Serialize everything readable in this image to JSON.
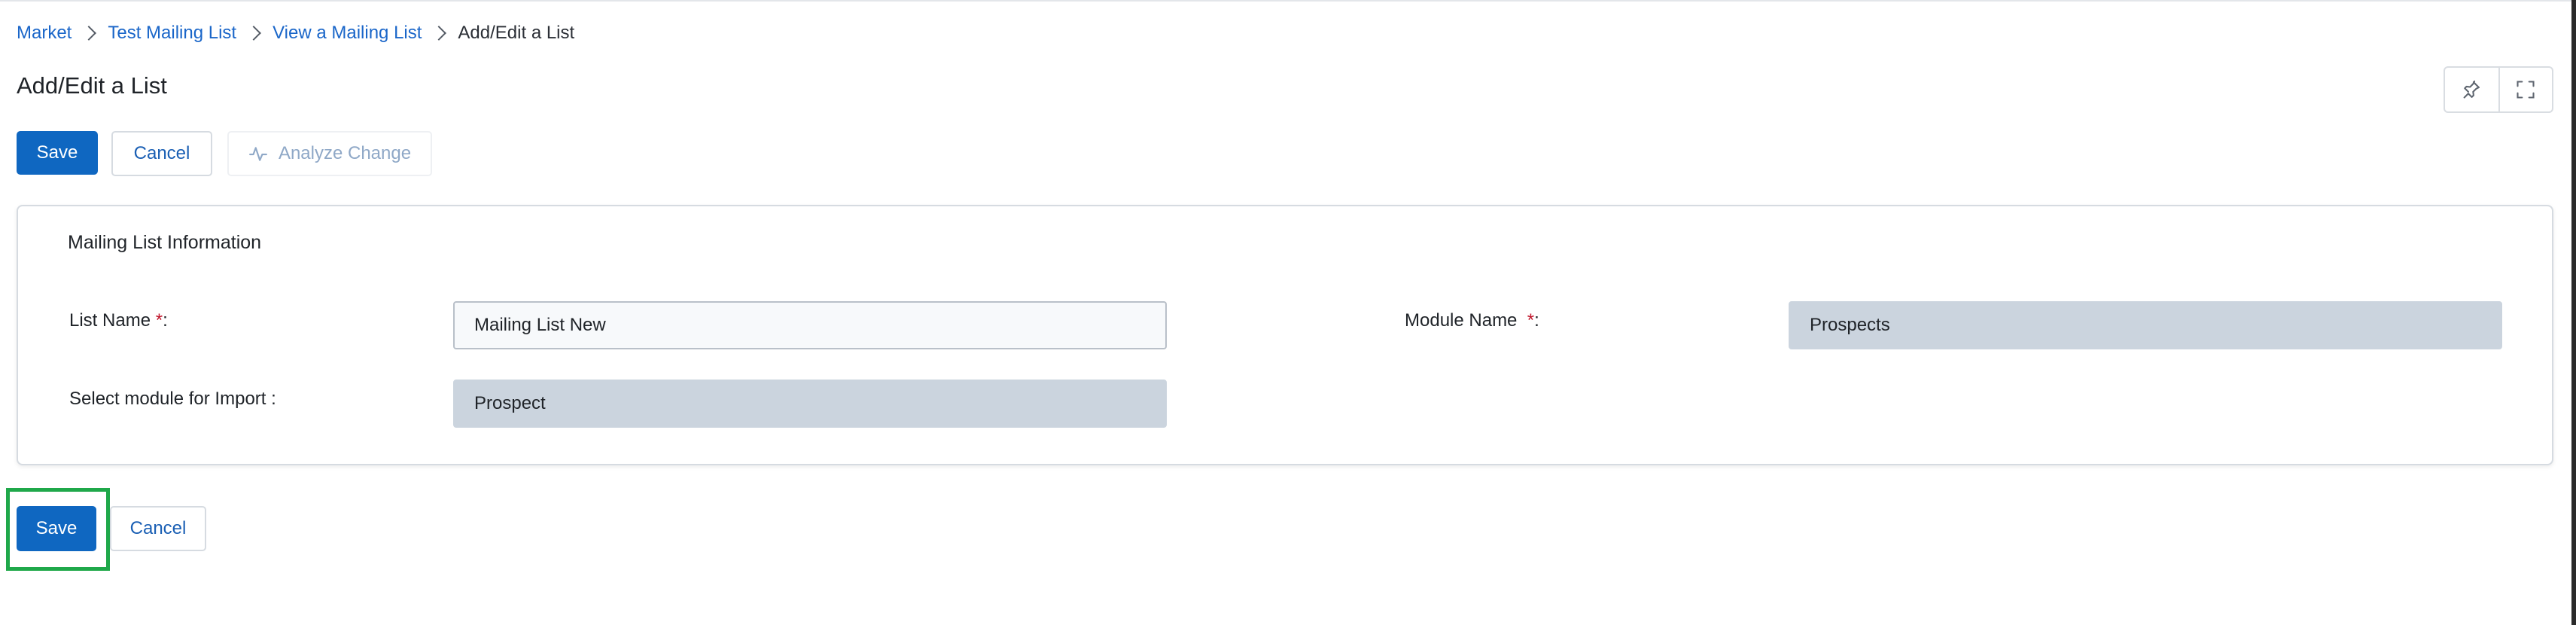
{
  "breadcrumb": {
    "items": [
      "Market",
      "Test Mailing List",
      "View a Mailing List"
    ],
    "current": "Add/Edit a List"
  },
  "page": {
    "title": "Add/Edit a List"
  },
  "toolbar": {
    "save_label": "Save",
    "cancel_label": "Cancel",
    "analyze_label": "Analyze Change"
  },
  "panel": {
    "title": "Mailing List Information",
    "fields": {
      "list_name": {
        "label": "List Name",
        "required_mark": "*",
        "suffix": ":",
        "value": "Mailing List New"
      },
      "module_name": {
        "label": "Module Name",
        "required_mark": "*",
        "suffix": ":",
        "value": "Prospects"
      },
      "import_module": {
        "label": "Select module for Import :",
        "value": "Prospect"
      }
    }
  },
  "footer": {
    "save_label": "Save",
    "cancel_label": "Cancel"
  },
  "icons": {
    "pin": "pin-icon",
    "fullscreen": "fullscreen-icon",
    "analyze": "activity-icon"
  },
  "colors": {
    "primary": "#0f67c1",
    "link": "#1a66c9",
    "required": "#c0142a",
    "readonly_field": "#cbd4de",
    "highlight": "#1fa84a"
  }
}
